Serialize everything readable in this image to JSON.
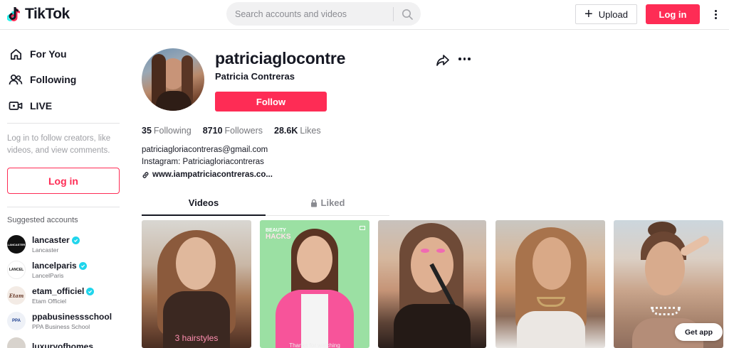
{
  "header": {
    "logo_text": "TikTok",
    "search_placeholder": "Search accounts and videos",
    "upload_label": "Upload",
    "login_label": "Log in"
  },
  "sidebar": {
    "nav": [
      {
        "label": "For You",
        "icon": "home-icon"
      },
      {
        "label": "Following",
        "icon": "users-icon"
      },
      {
        "label": "LIVE",
        "icon": "live-icon"
      }
    ],
    "login_hint": "Log in to follow creators, like videos, and view comments.",
    "login_label": "Log in",
    "suggested_title": "Suggested accounts",
    "accounts": [
      {
        "name": "lancaster",
        "sub": "Lancaster",
        "verified": true,
        "avatar_text": "LANCASTER"
      },
      {
        "name": "lancelparis",
        "sub": "LancelParis",
        "verified": true,
        "avatar_text": "LANCEL"
      },
      {
        "name": "etam_officiel",
        "sub": "Etam Officiel",
        "verified": true,
        "avatar_text": "Etam"
      },
      {
        "name": "ppabusinessschool",
        "sub": "PPA Business School",
        "verified": false,
        "avatar_text": "PPA"
      },
      {
        "name": "luxuryofhomes",
        "sub": "",
        "verified": false,
        "avatar_text": ""
      }
    ]
  },
  "profile": {
    "username": "patriciaglocontre",
    "full_name": "Patricia Contreras",
    "follow_label": "Follow",
    "stats": [
      {
        "value": "35",
        "label": "Following"
      },
      {
        "value": "8710",
        "label": "Followers"
      },
      {
        "value": "28.6K",
        "label": "Likes"
      }
    ],
    "bio_line1": "patriciagloriacontreras@gmail.com",
    "bio_line2": "Instagram: Patriciagloriacontreras",
    "link": "www.iampatriciacontreras.co..."
  },
  "tabs": {
    "videos": "Videos",
    "liked": "Liked"
  },
  "videos": [
    {
      "caption": "3 hairstyles",
      "caption2": ""
    },
    {
      "tag_top": "BEAUTY",
      "tag_bottom": "HACKS",
      "caption2": "Thanks for watching"
    },
    {
      "caption": ""
    },
    {
      "caption": ""
    },
    {
      "caption": ""
    }
  ],
  "get_app_label": "Get app",
  "colors": {
    "brand": "#fe2c55",
    "verified": "#20d5ec",
    "text_primary": "#161823",
    "text_secondary": "#75767b"
  }
}
